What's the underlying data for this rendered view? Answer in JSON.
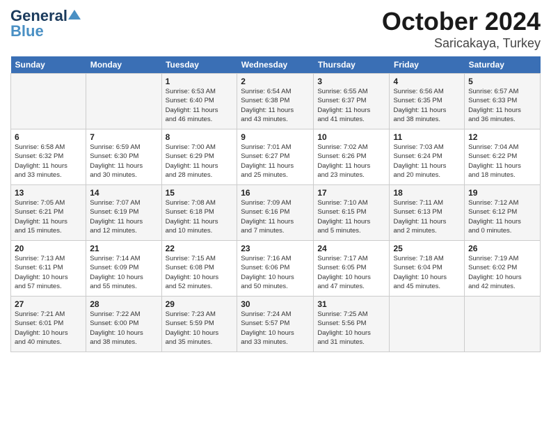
{
  "header": {
    "logo_general": "General",
    "logo_blue": "Blue",
    "month": "October 2024",
    "location": "Saricakaya, Turkey"
  },
  "weekdays": [
    "Sunday",
    "Monday",
    "Tuesday",
    "Wednesday",
    "Thursday",
    "Friday",
    "Saturday"
  ],
  "weeks": [
    [
      {
        "day": "",
        "info": ""
      },
      {
        "day": "",
        "info": ""
      },
      {
        "day": "1",
        "info": "Sunrise: 6:53 AM\nSunset: 6:40 PM\nDaylight: 11 hours\nand 46 minutes."
      },
      {
        "day": "2",
        "info": "Sunrise: 6:54 AM\nSunset: 6:38 PM\nDaylight: 11 hours\nand 43 minutes."
      },
      {
        "day": "3",
        "info": "Sunrise: 6:55 AM\nSunset: 6:37 PM\nDaylight: 11 hours\nand 41 minutes."
      },
      {
        "day": "4",
        "info": "Sunrise: 6:56 AM\nSunset: 6:35 PM\nDaylight: 11 hours\nand 38 minutes."
      },
      {
        "day": "5",
        "info": "Sunrise: 6:57 AM\nSunset: 6:33 PM\nDaylight: 11 hours\nand 36 minutes."
      }
    ],
    [
      {
        "day": "6",
        "info": "Sunrise: 6:58 AM\nSunset: 6:32 PM\nDaylight: 11 hours\nand 33 minutes."
      },
      {
        "day": "7",
        "info": "Sunrise: 6:59 AM\nSunset: 6:30 PM\nDaylight: 11 hours\nand 30 minutes."
      },
      {
        "day": "8",
        "info": "Sunrise: 7:00 AM\nSunset: 6:29 PM\nDaylight: 11 hours\nand 28 minutes."
      },
      {
        "day": "9",
        "info": "Sunrise: 7:01 AM\nSunset: 6:27 PM\nDaylight: 11 hours\nand 25 minutes."
      },
      {
        "day": "10",
        "info": "Sunrise: 7:02 AM\nSunset: 6:26 PM\nDaylight: 11 hours\nand 23 minutes."
      },
      {
        "day": "11",
        "info": "Sunrise: 7:03 AM\nSunset: 6:24 PM\nDaylight: 11 hours\nand 20 minutes."
      },
      {
        "day": "12",
        "info": "Sunrise: 7:04 AM\nSunset: 6:22 PM\nDaylight: 11 hours\nand 18 minutes."
      }
    ],
    [
      {
        "day": "13",
        "info": "Sunrise: 7:05 AM\nSunset: 6:21 PM\nDaylight: 11 hours\nand 15 minutes."
      },
      {
        "day": "14",
        "info": "Sunrise: 7:07 AM\nSunset: 6:19 PM\nDaylight: 11 hours\nand 12 minutes."
      },
      {
        "day": "15",
        "info": "Sunrise: 7:08 AM\nSunset: 6:18 PM\nDaylight: 11 hours\nand 10 minutes."
      },
      {
        "day": "16",
        "info": "Sunrise: 7:09 AM\nSunset: 6:16 PM\nDaylight: 11 hours\nand 7 minutes."
      },
      {
        "day": "17",
        "info": "Sunrise: 7:10 AM\nSunset: 6:15 PM\nDaylight: 11 hours\nand 5 minutes."
      },
      {
        "day": "18",
        "info": "Sunrise: 7:11 AM\nSunset: 6:13 PM\nDaylight: 11 hours\nand 2 minutes."
      },
      {
        "day": "19",
        "info": "Sunrise: 7:12 AM\nSunset: 6:12 PM\nDaylight: 11 hours\nand 0 minutes."
      }
    ],
    [
      {
        "day": "20",
        "info": "Sunrise: 7:13 AM\nSunset: 6:11 PM\nDaylight: 10 hours\nand 57 minutes."
      },
      {
        "day": "21",
        "info": "Sunrise: 7:14 AM\nSunset: 6:09 PM\nDaylight: 10 hours\nand 55 minutes."
      },
      {
        "day": "22",
        "info": "Sunrise: 7:15 AM\nSunset: 6:08 PM\nDaylight: 10 hours\nand 52 minutes."
      },
      {
        "day": "23",
        "info": "Sunrise: 7:16 AM\nSunset: 6:06 PM\nDaylight: 10 hours\nand 50 minutes."
      },
      {
        "day": "24",
        "info": "Sunrise: 7:17 AM\nSunset: 6:05 PM\nDaylight: 10 hours\nand 47 minutes."
      },
      {
        "day": "25",
        "info": "Sunrise: 7:18 AM\nSunset: 6:04 PM\nDaylight: 10 hours\nand 45 minutes."
      },
      {
        "day": "26",
        "info": "Sunrise: 7:19 AM\nSunset: 6:02 PM\nDaylight: 10 hours\nand 42 minutes."
      }
    ],
    [
      {
        "day": "27",
        "info": "Sunrise: 7:21 AM\nSunset: 6:01 PM\nDaylight: 10 hours\nand 40 minutes."
      },
      {
        "day": "28",
        "info": "Sunrise: 7:22 AM\nSunset: 6:00 PM\nDaylight: 10 hours\nand 38 minutes."
      },
      {
        "day": "29",
        "info": "Sunrise: 7:23 AM\nSunset: 5:59 PM\nDaylight: 10 hours\nand 35 minutes."
      },
      {
        "day": "30",
        "info": "Sunrise: 7:24 AM\nSunset: 5:57 PM\nDaylight: 10 hours\nand 33 minutes."
      },
      {
        "day": "31",
        "info": "Sunrise: 7:25 AM\nSunset: 5:56 PM\nDaylight: 10 hours\nand 31 minutes."
      },
      {
        "day": "",
        "info": ""
      },
      {
        "day": "",
        "info": ""
      }
    ]
  ]
}
